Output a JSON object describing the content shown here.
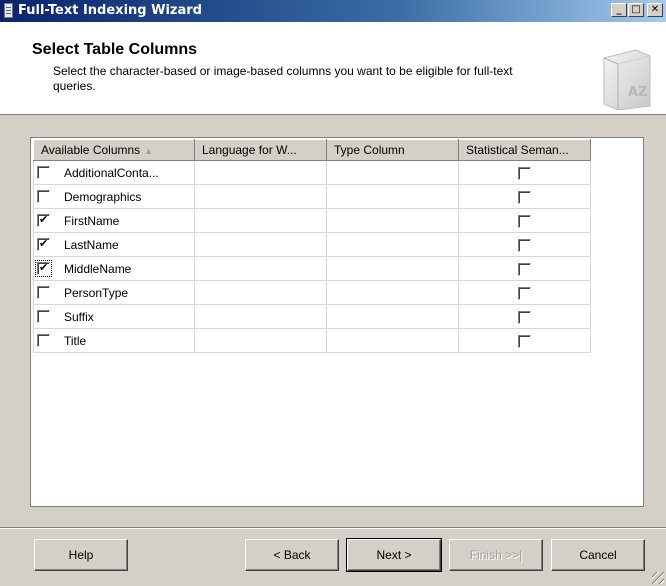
{
  "window": {
    "title": "Full-Text Indexing Wizard",
    "minimize_glyph": "_",
    "maximize_glyph": "□",
    "close_glyph": "✕"
  },
  "header": {
    "title": "Select Table Columns",
    "description": "Select the character-based or image-based columns you want to be eligible for full-text queries.",
    "icon": "book-az-icon",
    "icon_text": "AZ"
  },
  "grid": {
    "columns": [
      "Available Columns",
      "Language for W...",
      "Type Column",
      "Statistical Seman..."
    ],
    "sort_indicator": "▲",
    "rows": [
      {
        "name": "AdditionalConta...",
        "checked": false,
        "language": "",
        "type": "",
        "statistical": false
      },
      {
        "name": "Demographics",
        "checked": false,
        "language": "",
        "type": "",
        "statistical": false
      },
      {
        "name": "FirstName",
        "checked": true,
        "language": "",
        "type": "",
        "statistical": false
      },
      {
        "name": "LastName",
        "checked": true,
        "language": "",
        "type": "",
        "statistical": false
      },
      {
        "name": "MiddleName",
        "checked": true,
        "language": "",
        "type": "",
        "statistical": false
      },
      {
        "name": "PersonType",
        "checked": false,
        "language": "",
        "type": "",
        "statistical": false
      },
      {
        "name": "Suffix",
        "checked": false,
        "language": "",
        "type": "",
        "statistical": false
      },
      {
        "name": "Title",
        "checked": false,
        "language": "",
        "type": "",
        "statistical": false
      }
    ]
  },
  "footer": {
    "help": "Help",
    "back": "< Back",
    "next": "Next >",
    "finish": "Finish >>|",
    "cancel": "Cancel"
  },
  "colors": {
    "title_bar_start": "#0a246a",
    "title_bar_end": "#a6caf0",
    "dialog_face": "#d4d0c8"
  }
}
